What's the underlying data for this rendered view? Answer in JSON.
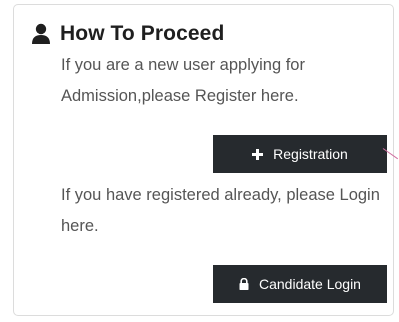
{
  "panel": {
    "title": "How To Proceed",
    "title_icon": "user-icon",
    "new_user_text": "If you are a new user applying for Admission,please Register here.",
    "registered_text": "If you have registered already, please Login here."
  },
  "buttons": {
    "registration": {
      "label": "Registration",
      "icon": "plus-icon"
    },
    "candidate_login": {
      "label": "Candidate Login",
      "icon": "lock-icon"
    }
  },
  "colors": {
    "button_bg": "#262a2e",
    "text": "#555555",
    "title": "#1f1f1f"
  }
}
